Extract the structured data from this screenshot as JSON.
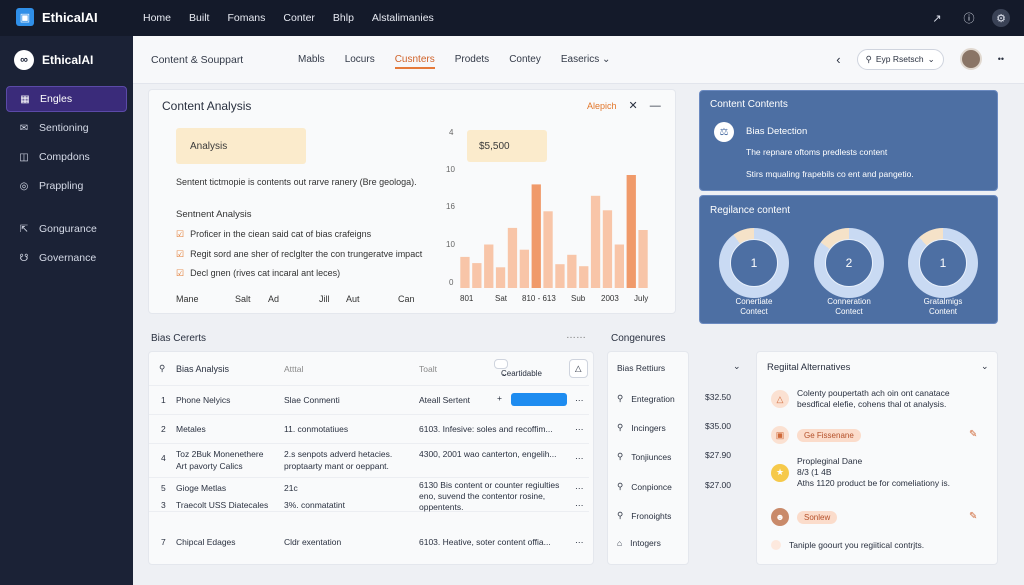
{
  "topbar": {
    "brand": "EthicalAI",
    "nav": [
      "Home",
      "Built",
      "Fomans",
      "Conter",
      "Bhlp",
      "Alstalimanies"
    ],
    "icons": [
      "exit-icon",
      "help-icon",
      "settings-icon"
    ]
  },
  "sidebar": {
    "brand": "EthicalAI",
    "items": [
      {
        "label": "Engles",
        "icon": "grid-icon",
        "active": true
      },
      {
        "label": "Sentioning",
        "icon": "mail-icon",
        "active": false
      },
      {
        "label": "Compdons",
        "icon": "lock-icon",
        "active": false
      },
      {
        "label": "Prappling",
        "icon": "target-icon",
        "active": false
      },
      {
        "label": "Gongurance",
        "icon": "link-icon",
        "active": false
      },
      {
        "label": "Governance",
        "icon": "shield-icon",
        "active": false
      }
    ]
  },
  "subheader": {
    "title": "Content & Souppart",
    "tabs": [
      "Mabls",
      "Locurs",
      "Cusnters",
      "Prodets",
      "Contey",
      "Easerics"
    ],
    "active_tab": "Cusnters",
    "search_pill": "Eyp Rsetsch"
  },
  "analysis": {
    "title": "Content Analysis",
    "action": "Alepich",
    "tooltip": "Analysis",
    "price_tooltip": "$5,500",
    "summary": "Sentent tictmopie is contents out rarve ranery (Bre geologa).",
    "section": "Sentnent Analysis",
    "checks": [
      "Proficer in the ciean said cat of bias crafeigns",
      "Regit sord ane sher of reclglter the con trungeratve impact",
      "Decl gnen (rives cat incaral ant leces)"
    ],
    "bottom_labels": [
      "Mane",
      "Salt",
      "Ad",
      "Jill",
      "Aut",
      "Can"
    ],
    "x_labels": [
      "801",
      "Sat",
      "810 - 613",
      "Sub",
      "2003",
      "July"
    ],
    "y_labels": [
      "4",
      "10",
      "16",
      "10",
      "0"
    ]
  },
  "chart_data": {
    "type": "bar",
    "bars": [
      {
        "value": 3.0,
        "tone": "light"
      },
      {
        "value": 2.4,
        "tone": "light"
      },
      {
        "value": 4.2,
        "tone": "light"
      },
      {
        "value": 2.0,
        "tone": "light"
      },
      {
        "value": 5.8,
        "tone": "light"
      },
      {
        "value": 3.7,
        "tone": "light"
      },
      {
        "value": 10.0,
        "tone": "dark"
      },
      {
        "value": 7.4,
        "tone": "light"
      },
      {
        "value": 2.3,
        "tone": "light"
      },
      {
        "value": 3.2,
        "tone": "light"
      },
      {
        "value": 2.1,
        "tone": "light"
      },
      {
        "value": 8.9,
        "tone": "light"
      },
      {
        "value": 7.5,
        "tone": "light"
      },
      {
        "value": 4.2,
        "tone": "light"
      },
      {
        "value": 10.9,
        "tone": "dark"
      },
      {
        "value": 5.6,
        "tone": "light"
      }
    ],
    "colors": {
      "light": "#f8c5a8",
      "dark": "#f09a6a"
    }
  },
  "content_contents": {
    "title": "Content Contents",
    "item_title": "Bias Detection",
    "lines": [
      "The repnare oftoms predlests content",
      "Stirs mqualing frapebils co ent and pangetio."
    ]
  },
  "regilance": {
    "title": "Regilance content",
    "donuts": [
      {
        "value": "1",
        "label": "Conertiate\nContect",
        "fraction": 0.9
      },
      {
        "value": "2",
        "label": "Conneration\nContect",
        "fraction": 0.85
      },
      {
        "value": "1",
        "label": "Gratalmigs\nContent",
        "fraction": 0.88
      }
    ]
  },
  "bias": {
    "title": "Bias Cererts",
    "search_label": "Bias Analysis",
    "col2": "Atttal",
    "col3": "Toalt",
    "dropdown": "Ceartidable",
    "rows": [
      {
        "n": "1",
        "a": "Phone Nelyics",
        "b": "Slae Conmenti",
        "c": "Ateall Sertent"
      },
      {
        "n": "2",
        "a": "Metales",
        "b": "11. conmotatiues",
        "c": "6103. Infesive: soles and recoffim..."
      },
      {
        "n": "4",
        "a": "Toz 2Buk Monenethere",
        "a2": "Art pavorty Calics",
        "b": "2.s senpots adverd hetacies.",
        "b2": "proptaarty mant or oeppant.",
        "c": "4300, 2001 wao canterton, engelih..."
      },
      {
        "n": "5",
        "a": "Gioge Metlas",
        "b": "21c",
        "c": "6130 Bis content or counter regiulties",
        "c2": "eno, suvend the contentor rosine,",
        "c3": "oppentents."
      },
      {
        "n": "3",
        "a": "Traecolt USS Diatecales",
        "b": "3%. conmatatint"
      },
      {
        "n": "7",
        "a": "Chipcal Edages",
        "b": "Cldr exentation",
        "c": "6103. Heative, soter content offia..."
      }
    ]
  },
  "congenures": {
    "title": "Congenures",
    "header": "Bias Rettiurs",
    "items": [
      {
        "label": "Entegration",
        "price": "$32.50",
        "icon": "pin-icon"
      },
      {
        "label": "Incingers",
        "price": "$35.00",
        "icon": "pin-icon"
      },
      {
        "label": "Tonjiunces",
        "price": "$27.90",
        "icon": "pin-icon"
      },
      {
        "label": "Conpionce",
        "price": "$27.00",
        "icon": "pin-icon"
      },
      {
        "label": "Fronoights",
        "price": "",
        "icon": "pin-icon"
      },
      {
        "label": "Intogers",
        "price": "",
        "icon": "home-icon"
      }
    ]
  },
  "alternatives": {
    "title": "Regiital Alternatives",
    "items": [
      {
        "line1": "Colenty poupertath ach oin ont canatace",
        "line2": "besdfical elefie, cohens thal ot analysis."
      },
      {
        "tag": "Ge Fissenane"
      },
      {
        "line1": "Propleginal Dane",
        "line2": "8/3 (1 4B",
        "line3": "Aths 1120 product be for comeliationy is."
      },
      {
        "tag": "Sonlew"
      },
      {
        "line1": "Taniple goourt you regiitical contrjts."
      }
    ]
  }
}
